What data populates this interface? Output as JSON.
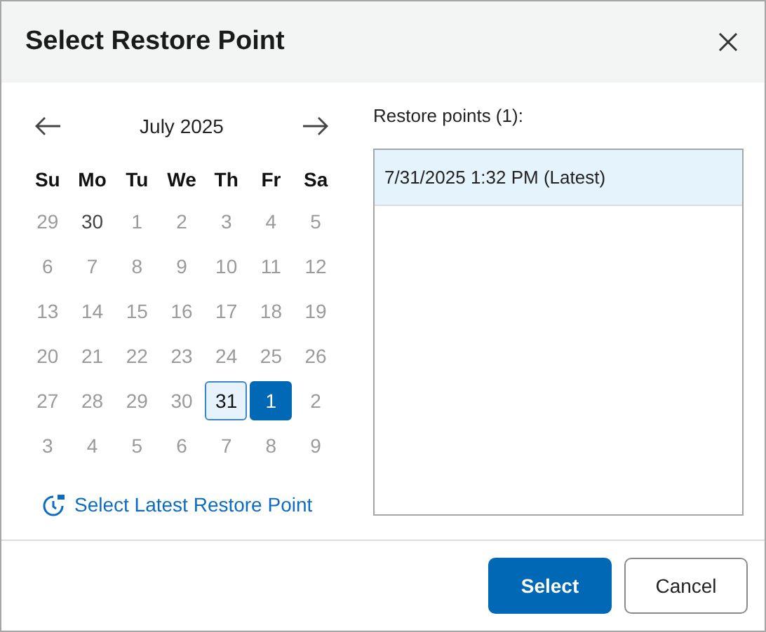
{
  "dialog": {
    "title": "Select Restore Point"
  },
  "calendar": {
    "month": "July 2025",
    "weekdays": [
      "Su",
      "Mo",
      "Tu",
      "We",
      "Th",
      "Fr",
      "Sa"
    ],
    "days": [
      {
        "label": "29",
        "enabled": false,
        "highlighted": false,
        "selected": false
      },
      {
        "label": "30",
        "enabled": true,
        "highlighted": false,
        "selected": false
      },
      {
        "label": "1",
        "enabled": false,
        "highlighted": false,
        "selected": false
      },
      {
        "label": "2",
        "enabled": false,
        "highlighted": false,
        "selected": false
      },
      {
        "label": "3",
        "enabled": false,
        "highlighted": false,
        "selected": false
      },
      {
        "label": "4",
        "enabled": false,
        "highlighted": false,
        "selected": false
      },
      {
        "label": "5",
        "enabled": false,
        "highlighted": false,
        "selected": false
      },
      {
        "label": "6",
        "enabled": false,
        "highlighted": false,
        "selected": false
      },
      {
        "label": "7",
        "enabled": false,
        "highlighted": false,
        "selected": false
      },
      {
        "label": "8",
        "enabled": false,
        "highlighted": false,
        "selected": false
      },
      {
        "label": "9",
        "enabled": false,
        "highlighted": false,
        "selected": false
      },
      {
        "label": "10",
        "enabled": false,
        "highlighted": false,
        "selected": false
      },
      {
        "label": "11",
        "enabled": false,
        "highlighted": false,
        "selected": false
      },
      {
        "label": "12",
        "enabled": false,
        "highlighted": false,
        "selected": false
      },
      {
        "label": "13",
        "enabled": false,
        "highlighted": false,
        "selected": false
      },
      {
        "label": "14",
        "enabled": false,
        "highlighted": false,
        "selected": false
      },
      {
        "label": "15",
        "enabled": false,
        "highlighted": false,
        "selected": false
      },
      {
        "label": "16",
        "enabled": false,
        "highlighted": false,
        "selected": false
      },
      {
        "label": "17",
        "enabled": false,
        "highlighted": false,
        "selected": false
      },
      {
        "label": "18",
        "enabled": false,
        "highlighted": false,
        "selected": false
      },
      {
        "label": "19",
        "enabled": false,
        "highlighted": false,
        "selected": false
      },
      {
        "label": "20",
        "enabled": false,
        "highlighted": false,
        "selected": false
      },
      {
        "label": "21",
        "enabled": false,
        "highlighted": false,
        "selected": false
      },
      {
        "label": "22",
        "enabled": false,
        "highlighted": false,
        "selected": false
      },
      {
        "label": "23",
        "enabled": false,
        "highlighted": false,
        "selected": false
      },
      {
        "label": "24",
        "enabled": false,
        "highlighted": false,
        "selected": false
      },
      {
        "label": "25",
        "enabled": false,
        "highlighted": false,
        "selected": false
      },
      {
        "label": "26",
        "enabled": false,
        "highlighted": false,
        "selected": false
      },
      {
        "label": "27",
        "enabled": false,
        "highlighted": false,
        "selected": false
      },
      {
        "label": "28",
        "enabled": false,
        "highlighted": false,
        "selected": false
      },
      {
        "label": "29",
        "enabled": false,
        "highlighted": false,
        "selected": false
      },
      {
        "label": "30",
        "enabled": false,
        "highlighted": false,
        "selected": false
      },
      {
        "label": "31",
        "enabled": true,
        "highlighted": true,
        "selected": false
      },
      {
        "label": "1",
        "enabled": true,
        "highlighted": false,
        "selected": true
      },
      {
        "label": "2",
        "enabled": false,
        "highlighted": false,
        "selected": false
      },
      {
        "label": "3",
        "enabled": false,
        "highlighted": false,
        "selected": false
      },
      {
        "label": "4",
        "enabled": false,
        "highlighted": false,
        "selected": false
      },
      {
        "label": "5",
        "enabled": false,
        "highlighted": false,
        "selected": false
      },
      {
        "label": "6",
        "enabled": false,
        "highlighted": false,
        "selected": false
      },
      {
        "label": "7",
        "enabled": false,
        "highlighted": false,
        "selected": false
      },
      {
        "label": "8",
        "enabled": false,
        "highlighted": false,
        "selected": false
      },
      {
        "label": "9",
        "enabled": false,
        "highlighted": false,
        "selected": false
      }
    ]
  },
  "latest_link": "Select Latest Restore Point",
  "restore_points": {
    "label": "Restore points (1):",
    "items": [
      {
        "text": "7/31/2025 1:32 PM (Latest)",
        "selected": true
      }
    ]
  },
  "buttons": [
    {
      "label": "Select",
      "kind": "primary"
    },
    {
      "label": "Cancel",
      "kind": "secondary"
    }
  ]
}
